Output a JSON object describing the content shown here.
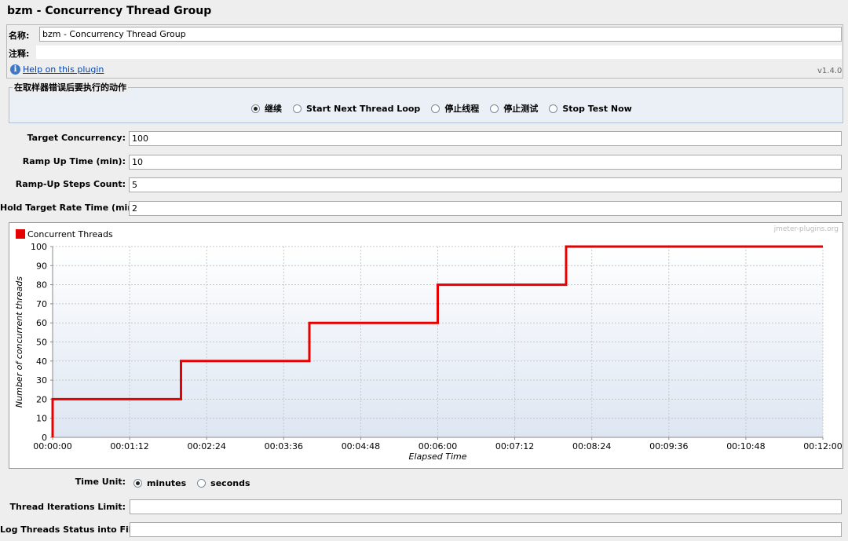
{
  "window": {
    "title": "bzm - Concurrency Thread Group"
  },
  "name_section": {
    "name_label": "名称:",
    "name_value": "bzm - Concurrency Thread Group",
    "comment_label": "注释:",
    "comment_value": "",
    "help_link": "Help on this plugin",
    "version": "v1.4.0"
  },
  "error_action": {
    "legend": "在取样器错误后要执行的动作",
    "options": [
      {
        "label": "继续",
        "selected": true
      },
      {
        "label": "Start Next Thread Loop",
        "selected": false
      },
      {
        "label": "停止线程",
        "selected": false
      },
      {
        "label": "停止测试",
        "selected": false
      },
      {
        "label": "Stop Test Now",
        "selected": false
      }
    ]
  },
  "fields": {
    "target_concurrency": {
      "label": "Target Concurrency:",
      "value": "100"
    },
    "ramp_up_time": {
      "label": "Ramp Up Time (min):",
      "value": "10"
    },
    "ramp_up_steps": {
      "label": "Ramp-Up Steps Count:",
      "value": "5"
    },
    "hold_time": {
      "label": "Hold Target Rate Time (min):",
      "value": "2"
    }
  },
  "time_unit": {
    "label": "Time Unit:",
    "options": [
      {
        "label": "minutes",
        "selected": true
      },
      {
        "label": "seconds",
        "selected": false
      }
    ]
  },
  "thread_iterations": {
    "label": "Thread Iterations Limit:",
    "value": ""
  },
  "log_threads": {
    "label": "Log Threads Status into File:",
    "value": ""
  },
  "colors": {
    "series": "#e60000",
    "plot_bg_top": "#ffffff",
    "plot_bg_bottom": "#dde6f2",
    "link": "#0645ad"
  },
  "chart_data": {
    "type": "line",
    "watermark": "jmeter-plugins.org",
    "xlabel": "Elapsed Time",
    "ylabel": "Number of concurrent threads",
    "ylim": [
      0,
      100
    ],
    "xlim": [
      0,
      720
    ],
    "yticks": [
      0,
      10,
      20,
      30,
      40,
      50,
      60,
      70,
      80,
      90,
      100
    ],
    "xtick_values": [
      0,
      72,
      144,
      216,
      288,
      360,
      432,
      504,
      576,
      648,
      720
    ],
    "xtick_labels": [
      "00:00:00",
      "00:01:12",
      "00:02:24",
      "00:03:36",
      "00:04:48",
      "00:06:00",
      "00:07:12",
      "00:08:24",
      "00:09:36",
      "00:10:48",
      "00:12:00"
    ],
    "grid": true,
    "legend": "top-left",
    "series": [
      {
        "name": "Concurrent Threads",
        "x": [
          0,
          0,
          120,
          120,
          240,
          240,
          360,
          360,
          480,
          480,
          720
        ],
        "y": [
          0,
          20,
          20,
          40,
          40,
          60,
          60,
          80,
          80,
          100,
          100
        ]
      }
    ]
  }
}
